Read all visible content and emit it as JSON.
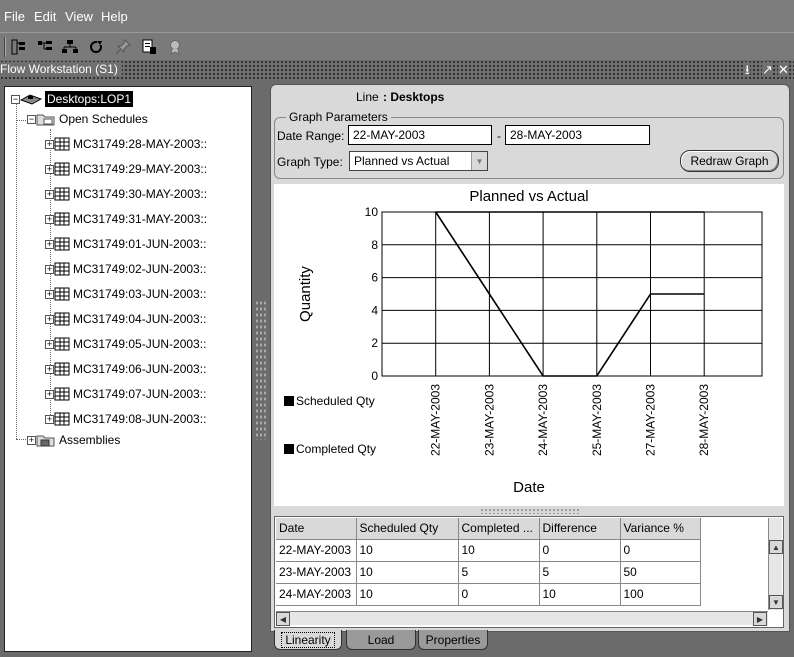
{
  "menu": [
    "File",
    "Edit",
    "View",
    "Help"
  ],
  "window": {
    "title": "Flow Workstation  (S1)",
    "controls": [
      "⭳",
      "↗",
      "✕"
    ]
  },
  "tree": {
    "root": "Desktops:LOP1",
    "open_schedules": "Open Schedules",
    "schedules": [
      "MC31749:28-MAY-2003::",
      "MC31749:29-MAY-2003::",
      "MC31749:30-MAY-2003::",
      "MC31749:31-MAY-2003::",
      "MC31749:01-JUN-2003::",
      "MC31749:02-JUN-2003::",
      "MC31749:03-JUN-2003::",
      "MC31749:04-JUN-2003::",
      "MC31749:05-JUN-2003::",
      "MC31749:06-JUN-2003::",
      "MC31749:07-JUN-2003::",
      "MC31749:08-JUN-2003::"
    ],
    "assemblies": "Assemblies"
  },
  "line": {
    "label": "Line",
    "value": ": Desktops"
  },
  "params": {
    "group_label": "Graph Parameters",
    "date_range_label": "Date Range:",
    "date_from": "22-MAY-2003",
    "date_sep": "-",
    "date_to": "28-MAY-2003",
    "graph_type_label": "Graph Type:",
    "graph_type": "Planned vs Actual",
    "redraw_label": "Redraw Graph"
  },
  "chart_data": {
    "type": "line",
    "title": "Planned vs Actual",
    "xlabel": "Date",
    "ylabel": "Quantity",
    "categories": [
      "22-MAY-2003",
      "23-MAY-2003",
      "24-MAY-2003",
      "25-MAY-2003",
      "27-MAY-2003",
      "28-MAY-2003"
    ],
    "series": [
      {
        "name": "Scheduled Qty",
        "values": [
          10,
          10,
          10,
          10,
          10,
          10
        ]
      },
      {
        "name": "Completed Qty",
        "values": [
          10,
          5,
          0,
          0,
          5,
          5
        ]
      }
    ],
    "ylim": [
      0,
      10
    ],
    "yticks": [
      "0",
      "2",
      "4",
      "6",
      "8",
      "10"
    ],
    "grid": true,
    "legend": "left"
  },
  "table": {
    "columns": [
      "Date",
      "Scheduled Qty",
      "Completed ...",
      "Difference",
      "Variance %"
    ],
    "rows": [
      [
        "22-MAY-2003",
        "10",
        "10",
        "0",
        "0"
      ],
      [
        "23-MAY-2003",
        "10",
        "5",
        "5",
        "50"
      ],
      [
        "24-MAY-2003",
        "10",
        "0",
        "10",
        "100"
      ]
    ]
  },
  "tabs": [
    "Linearity",
    "Load",
    "Properties"
  ]
}
